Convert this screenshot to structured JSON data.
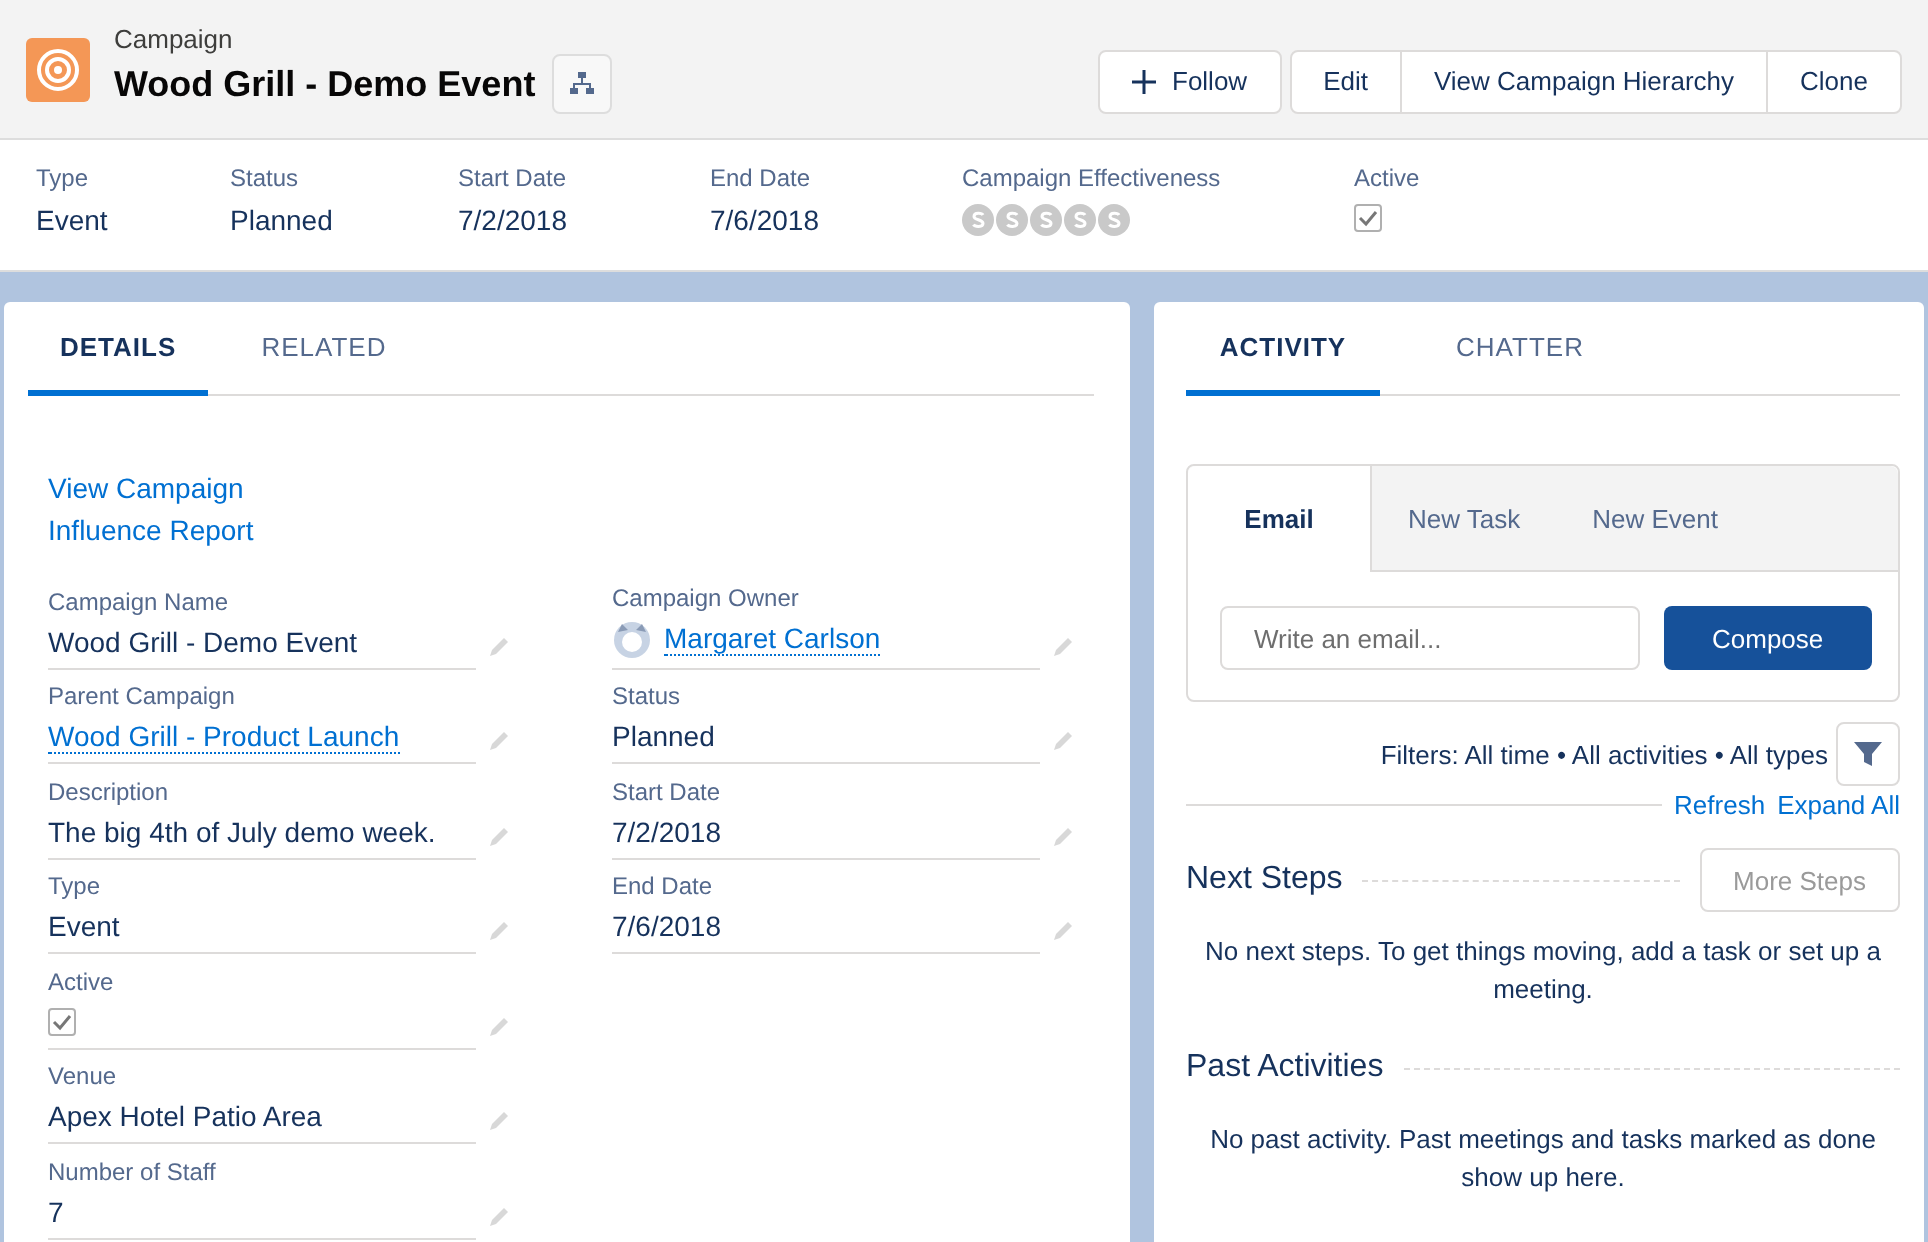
{
  "header": {
    "object_type": "Campaign",
    "title": "Wood Grill - Demo Event",
    "actions": [
      {
        "label": "Follow",
        "kind": "follow"
      },
      {
        "label": "Edit",
        "kind": "group"
      },
      {
        "label": "View Campaign Hierarchy",
        "kind": "group"
      },
      {
        "label": "Clone",
        "kind": "group"
      }
    ]
  },
  "highlights": [
    {
      "label": "Type",
      "kind": "text",
      "value": "Event"
    },
    {
      "label": "Status",
      "kind": "text",
      "value": "Planned"
    },
    {
      "label": "Start Date",
      "kind": "text",
      "value": "7/2/2018"
    },
    {
      "label": "End Date",
      "kind": "text",
      "value": "7/6/2018"
    },
    {
      "label": "Campaign Effectiveness",
      "kind": "rating"
    },
    {
      "label": "Active",
      "kind": "checkbox",
      "checked": true
    }
  ],
  "details": {
    "tabs": [
      {
        "label": "DETAILS",
        "selected": true
      },
      {
        "label": "RELATED",
        "selected": false
      }
    ],
    "links": [
      "View Campaign",
      "Influence Report"
    ],
    "left_fields": [
      {
        "label": "Campaign Name",
        "kind": "text",
        "value": "Wood Grill - Demo Event"
      },
      {
        "label": "Parent Campaign",
        "kind": "link",
        "value": "Wood Grill - Product Launch"
      },
      {
        "label": "Description",
        "kind": "text",
        "value": "The big 4th of July demo week."
      },
      {
        "label": "Type",
        "kind": "text",
        "value": "Event"
      },
      {
        "label": "Active",
        "kind": "checkbox",
        "checked": true
      },
      {
        "label": "Venue",
        "kind": "text",
        "value": "Apex Hotel Patio Area"
      },
      {
        "label": "Number of Staff",
        "kind": "text",
        "value": "7"
      }
    ],
    "right_fields": [
      {
        "label": "Campaign Owner",
        "kind": "user",
        "value": "Margaret Carlson"
      },
      {
        "label": "Status",
        "kind": "text",
        "value": "Planned"
      },
      {
        "label": "Start Date",
        "kind": "text",
        "value": "7/2/2018"
      },
      {
        "label": "End Date",
        "kind": "text",
        "value": "7/6/2018"
      }
    ]
  },
  "activity": {
    "tabs": [
      {
        "label": "ACTIVITY",
        "selected": true
      },
      {
        "label": "CHATTER",
        "selected": false
      }
    ],
    "composer_tabs": [
      {
        "label": "Email",
        "selected": true
      },
      {
        "label": "New Task",
        "selected": false
      },
      {
        "label": "New Event",
        "selected": false
      }
    ],
    "email_field": {
      "placeholder": "Write an email..."
    },
    "compose_button": "Compose",
    "filters": "Filters: All time • All activities • All types",
    "links": [
      "Refresh",
      "Expand All"
    ],
    "sections": [
      {
        "title": "Next Steps",
        "button": {
          "label": "More Steps",
          "disabled": true
        },
        "message": "No next steps. To get things moving, add a task or set up a meeting."
      },
      {
        "title": "Past Activities",
        "message": "No past activity. Past meetings and tasks marked as done show up here."
      }
    ]
  }
}
